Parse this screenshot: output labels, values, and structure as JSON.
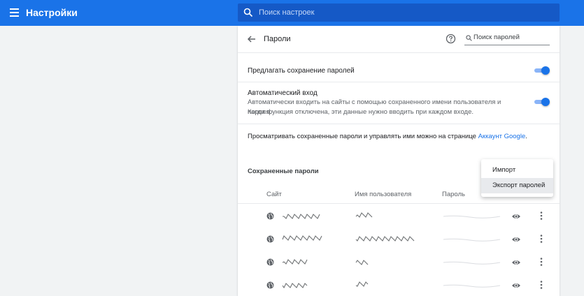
{
  "header": {
    "title": "Настройки",
    "search_placeholder": "Поиск настроек"
  },
  "passwords_page": {
    "title": "Пароли",
    "search_placeholder": "Поиск паролей",
    "offer_to_save": {
      "label": "Предлагать сохранение паролей",
      "enabled": true
    },
    "auto_signin": {
      "label": "Автоматический вход",
      "description_line1": "Автоматически входить на сайты с помощью сохраненного имени пользователя и пароля.",
      "description_line2": "Когда функция отключена, эти данные нужно вводить при каждом входе.",
      "enabled": true
    },
    "manage_text": "Просматривать сохраненные пароли и управлять ими можно на странице",
    "manage_link": "Аккаунт Google",
    "manage_suffix": ".",
    "saved_section": {
      "title": "Сохраненные пароли",
      "columns": [
        "Сайт",
        "Имя пользователя",
        "Пароль"
      ],
      "row_count": 4
    }
  },
  "export_menu": {
    "items": [
      "Импорт",
      "Экспорт паролей"
    ],
    "highlighted": "Экспорт паролей"
  },
  "icons": {
    "menu": "hamburger-menu-icon",
    "search": "search-icon",
    "back": "arrow-back-icon",
    "help": "help-circle-icon",
    "site": "globe-icon",
    "show_password": "eye-icon",
    "more": "more-vert-icon"
  },
  "colors": {
    "accent": "#1a73e8",
    "toggle_track": "#8ab4f8",
    "background": "#f1f3f4"
  }
}
